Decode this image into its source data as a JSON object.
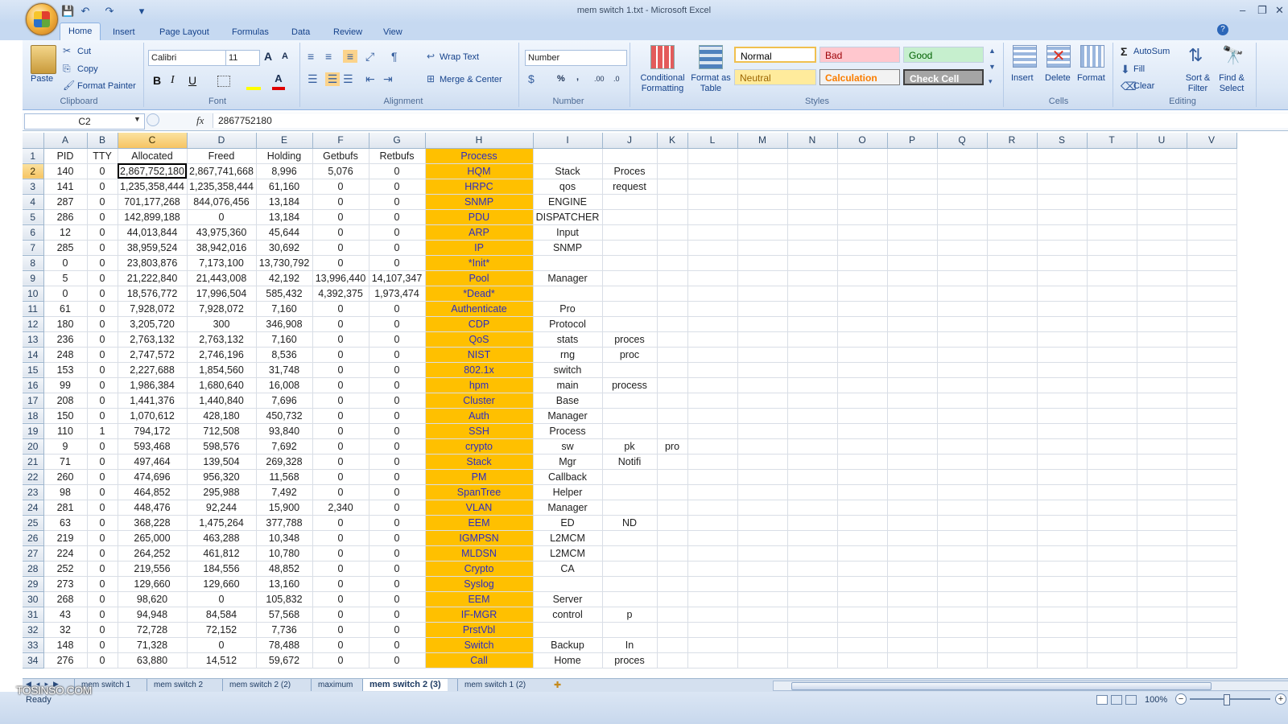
{
  "window": {
    "title": "mem switch 1.txt - Microsoft Excel",
    "minimize": "–",
    "restore": "❐",
    "close": "✕",
    "help": "?"
  },
  "qat": {
    "save": "💾",
    "undo": "↶",
    "redo": "↷",
    "customize": "▾"
  },
  "tabs": [
    "Home",
    "Insert",
    "Page Layout",
    "Formulas",
    "Data",
    "Review",
    "View"
  ],
  "ribbon": {
    "clipboard": {
      "paste": "Paste",
      "cut": "Cut",
      "copy": "Copy",
      "format_painter": "Format Painter",
      "label": "Clipboard"
    },
    "font": {
      "name": "Calibri",
      "size": "11",
      "bold": "B",
      "italic": "I",
      "underline": "U",
      "grow": "A",
      "shrink": "A",
      "label": "Font"
    },
    "alignment": {
      "wrap": "Wrap Text",
      "merge": "Merge & Center",
      "label": "Alignment"
    },
    "number": {
      "format": "Number",
      "percent": "%",
      "comma": ",",
      "inc": ".00",
      "dec": ".0",
      "label": "Number"
    },
    "styles": {
      "conditional": "Conditional Formatting",
      "format_table": "Format as Table",
      "normal": "Normal",
      "bad": "Bad",
      "good": "Good",
      "neutral": "Neutral",
      "calculation": "Calculation",
      "check_cell": "Check Cell",
      "label": "Styles"
    },
    "cells": {
      "insert": "Insert",
      "delete": "Delete",
      "format": "Format",
      "label": "Cells"
    },
    "editing": {
      "autosum": "AutoSum",
      "fill": "Fill",
      "clear": "Clear",
      "sort": "Sort & Filter",
      "find": "Find & Select",
      "label": "Editing"
    }
  },
  "formula_bar": {
    "name_box": "C2",
    "fx": "fx",
    "value": "2867752180"
  },
  "columns": [
    "A",
    "B",
    "C",
    "D",
    "E",
    "F",
    "G",
    "H",
    "I",
    "J",
    "K",
    "L",
    "M",
    "N",
    "O",
    "P",
    "Q",
    "R",
    "S",
    "T",
    "U",
    "V"
  ],
  "rows": [
    [
      "PID",
      "TTY",
      "Allocated",
      "Freed",
      "Holding",
      "Getbufs",
      "Retbufs",
      "Process",
      "",
      "",
      "",
      "",
      "",
      "",
      "",
      "",
      "",
      "",
      "",
      "",
      "",
      ""
    ],
    [
      "140",
      "0",
      "2,867,752,180",
      "2,867,741,668",
      "8,996",
      "5,076",
      "0",
      "HQM",
      "Stack",
      "Proces",
      "",
      "",
      "",
      "",
      "",
      "",
      "",
      "",
      "",
      "",
      "",
      ""
    ],
    [
      "141",
      "0",
      "1,235,358,444",
      "1,235,358,444",
      "61,160",
      "0",
      "0",
      "HRPC",
      "qos",
      "request",
      "",
      "",
      "",
      "",
      "",
      "",
      "",
      "",
      "",
      "",
      "",
      ""
    ],
    [
      "287",
      "0",
      "701,177,268",
      "844,076,456",
      "13,184",
      "0",
      "0",
      "SNMP",
      "ENGINE",
      "",
      "",
      "",
      "",
      "",
      "",
      "",
      "",
      "",
      "",
      "",
      "",
      ""
    ],
    [
      "286",
      "0",
      "142,899,188",
      "0",
      "13,184",
      "0",
      "0",
      "PDU",
      "DISPATCHER",
      "",
      "",
      "",
      "",
      "",
      "",
      "",
      "",
      "",
      "",
      "",
      "",
      ""
    ],
    [
      "12",
      "0",
      "44,013,844",
      "43,975,360",
      "45,644",
      "0",
      "0",
      "ARP",
      "Input",
      "",
      "",
      "",
      "",
      "",
      "",
      "",
      "",
      "",
      "",
      "",
      "",
      ""
    ],
    [
      "285",
      "0",
      "38,959,524",
      "38,942,016",
      "30,692",
      "0",
      "0",
      "IP",
      "SNMP",
      "",
      "",
      "",
      "",
      "",
      "",
      "",
      "",
      "",
      "",
      "",
      "",
      ""
    ],
    [
      "0",
      "0",
      "23,803,876",
      "7,173,100",
      "13,730,792",
      "0",
      "0",
      "*Init*",
      "",
      "",
      "",
      "",
      "",
      "",
      "",
      "",
      "",
      "",
      "",
      "",
      "",
      ""
    ],
    [
      "5",
      "0",
      "21,222,840",
      "21,443,008",
      "42,192",
      "13,996,440",
      "14,107,347",
      "Pool",
      "Manager",
      "",
      "",
      "",
      "",
      "",
      "",
      "",
      "",
      "",
      "",
      "",
      "",
      ""
    ],
    [
      "0",
      "0",
      "18,576,772",
      "17,996,504",
      "585,432",
      "4,392,375",
      "1,973,474",
      "*Dead*",
      "",
      "",
      "",
      "",
      "",
      "",
      "",
      "",
      "",
      "",
      "",
      "",
      "",
      ""
    ],
    [
      "61",
      "0",
      "7,928,072",
      "7,928,072",
      "7,160",
      "0",
      "0",
      "Authenticate",
      "Pro",
      "",
      "",
      "",
      "",
      "",
      "",
      "",
      "",
      "",
      "",
      "",
      "",
      ""
    ],
    [
      "180",
      "0",
      "3,205,720",
      "300",
      "346,908",
      "0",
      "0",
      "CDP",
      "Protocol",
      "",
      "",
      "",
      "",
      "",
      "",
      "",
      "",
      "",
      "",
      "",
      "",
      ""
    ],
    [
      "236",
      "0",
      "2,763,132",
      "2,763,132",
      "7,160",
      "0",
      "0",
      "QoS",
      "stats",
      "proces",
      "",
      "",
      "",
      "",
      "",
      "",
      "",
      "",
      "",
      "",
      "",
      ""
    ],
    [
      "248",
      "0",
      "2,747,572",
      "2,746,196",
      "8,536",
      "0",
      "0",
      "NIST",
      "rng",
      "proc",
      "",
      "",
      "",
      "",
      "",
      "",
      "",
      "",
      "",
      "",
      "",
      ""
    ],
    [
      "153",
      "0",
      "2,227,688",
      "1,854,560",
      "31,748",
      "0",
      "0",
      "802.1x",
      "switch",
      "",
      "",
      "",
      "",
      "",
      "",
      "",
      "",
      "",
      "",
      "",
      "",
      ""
    ],
    [
      "99",
      "0",
      "1,986,384",
      "1,680,640",
      "16,008",
      "0",
      "0",
      "hpm",
      "main",
      "process",
      "",
      "",
      "",
      "",
      "",
      "",
      "",
      "",
      "",
      "",
      "",
      ""
    ],
    [
      "208",
      "0",
      "1,441,376",
      "1,440,840",
      "7,696",
      "0",
      "0",
      "Cluster",
      "Base",
      "",
      "",
      "",
      "",
      "",
      "",
      "",
      "",
      "",
      "",
      "",
      "",
      ""
    ],
    [
      "150",
      "0",
      "1,070,612",
      "428,180",
      "450,732",
      "0",
      "0",
      "Auth",
      "Manager",
      "",
      "",
      "",
      "",
      "",
      "",
      "",
      "",
      "",
      "",
      "",
      "",
      ""
    ],
    [
      "110",
      "1",
      "794,172",
      "712,508",
      "93,840",
      "0",
      "0",
      "SSH",
      "Process",
      "",
      "",
      "",
      "",
      "",
      "",
      "",
      "",
      "",
      "",
      "",
      "",
      ""
    ],
    [
      "9",
      "0",
      "593,468",
      "598,576",
      "7,692",
      "0",
      "0",
      "crypto",
      "sw",
      "pk",
      "pro",
      "",
      "",
      "",
      "",
      "",
      "",
      "",
      "",
      "",
      "",
      ""
    ],
    [
      "71",
      "0",
      "497,464",
      "139,504",
      "269,328",
      "0",
      "0",
      "Stack",
      "Mgr",
      "Notifi",
      "",
      "",
      "",
      "",
      "",
      "",
      "",
      "",
      "",
      "",
      "",
      ""
    ],
    [
      "260",
      "0",
      "474,696",
      "956,320",
      "11,568",
      "0",
      "0",
      "PM",
      "Callback",
      "",
      "",
      "",
      "",
      "",
      "",
      "",
      "",
      "",
      "",
      "",
      "",
      ""
    ],
    [
      "98",
      "0",
      "464,852",
      "295,988",
      "7,492",
      "0",
      "0",
      "SpanTree",
      "Helper",
      "",
      "",
      "",
      "",
      "",
      "",
      "",
      "",
      "",
      "",
      "",
      "",
      ""
    ],
    [
      "281",
      "0",
      "448,476",
      "92,244",
      "15,900",
      "2,340",
      "0",
      "VLAN",
      "Manager",
      "",
      "",
      "",
      "",
      "",
      "",
      "",
      "",
      "",
      "",
      "",
      "",
      ""
    ],
    [
      "63",
      "0",
      "368,228",
      "1,475,264",
      "377,788",
      "0",
      "0",
      "EEM",
      "ED",
      "ND",
      "",
      "",
      "",
      "",
      "",
      "",
      "",
      "",
      "",
      "",
      "",
      ""
    ],
    [
      "219",
      "0",
      "265,000",
      "463,288",
      "10,348",
      "0",
      "0",
      "IGMPSN",
      "L2MCM",
      "",
      "",
      "",
      "",
      "",
      "",
      "",
      "",
      "",
      "",
      "",
      "",
      ""
    ],
    [
      "224",
      "0",
      "264,252",
      "461,812",
      "10,780",
      "0",
      "0",
      "MLDSN",
      "L2MCM",
      "",
      "",
      "",
      "",
      "",
      "",
      "",
      "",
      "",
      "",
      "",
      "",
      ""
    ],
    [
      "252",
      "0",
      "219,556",
      "184,556",
      "48,852",
      "0",
      "0",
      "Crypto",
      "CA",
      "",
      "",
      "",
      "",
      "",
      "",
      "",
      "",
      "",
      "",
      "",
      "",
      ""
    ],
    [
      "273",
      "0",
      "129,660",
      "129,660",
      "13,160",
      "0",
      "0",
      "Syslog",
      "",
      "",
      "",
      "",
      "",
      "",
      "",
      "",
      "",
      "",
      "",
      "",
      "",
      ""
    ],
    [
      "268",
      "0",
      "98,620",
      "0",
      "105,832",
      "0",
      "0",
      "EEM",
      "Server",
      "",
      "",
      "",
      "",
      "",
      "",
      "",
      "",
      "",
      "",
      "",
      "",
      ""
    ],
    [
      "43",
      "0",
      "94,948",
      "84,584",
      "57,568",
      "0",
      "0",
      "IF-MGR",
      "control",
      "p",
      "",
      "",
      "",
      "",
      "",
      "",
      "",
      "",
      "",
      "",
      "",
      ""
    ],
    [
      "32",
      "0",
      "72,728",
      "72,152",
      "7,736",
      "0",
      "0",
      "PrstVbl",
      "",
      "",
      "",
      "",
      "",
      "",
      "",
      "",
      "",
      "",
      "",
      "",
      "",
      ""
    ],
    [
      "148",
      "0",
      "71,328",
      "0",
      "78,488",
      "0",
      "0",
      "Switch",
      "Backup",
      "In",
      "",
      "",
      "",
      "",
      "",
      "",
      "",
      "",
      "",
      "",
      "",
      ""
    ],
    [
      "276",
      "0",
      "63,880",
      "14,512",
      "59,672",
      "0",
      "0",
      "Call",
      "Home",
      "proces",
      "",
      "",
      "",
      "",
      "",
      "",
      "",
      "",
      "",
      "",
      "",
      ""
    ]
  ],
  "sheet_tabs": [
    "mem switch 1",
    "mem switch 2",
    "mem switch 2 (2)",
    "maximum",
    "mem switch 2 (3)",
    "mem switch 1 (2)"
  ],
  "active_sheet": "mem switch 2 (3)",
  "status": {
    "ready": "Ready",
    "zoom": "100%",
    "watermark": "TOSINSO.COM"
  }
}
